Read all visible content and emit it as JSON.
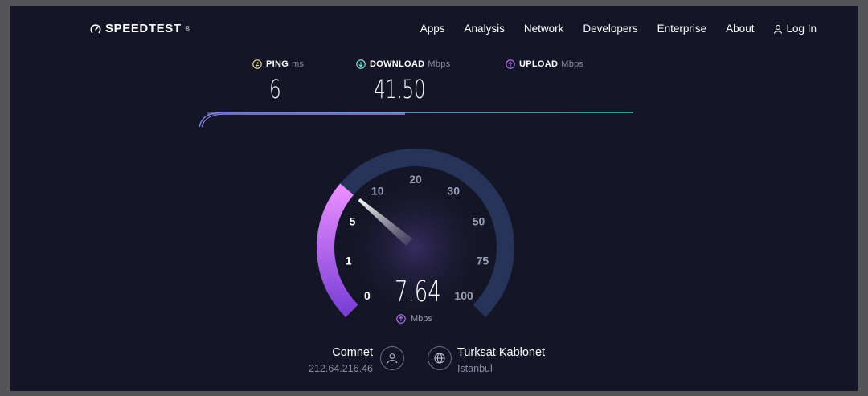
{
  "brand": {
    "name": "SPEEDTEST",
    "trademark": "®"
  },
  "nav": {
    "items": [
      "Apps",
      "Analysis",
      "Network",
      "Developers",
      "Enterprise",
      "About"
    ],
    "login": "Log In"
  },
  "metrics": {
    "ping": {
      "label": "PING",
      "unit": "ms",
      "value": "6",
      "color": "#f2e38b"
    },
    "download": {
      "label": "DOWNLOAD",
      "unit": "Mbps",
      "value": "41.50",
      "color": "#6afff3"
    },
    "upload": {
      "label": "UPLOAD",
      "unit": "Mbps",
      "value": "",
      "color": "#bf71ff"
    }
  },
  "gauge": {
    "ticks": [
      "0",
      "1",
      "5",
      "10",
      "20",
      "30",
      "50",
      "75",
      "100"
    ],
    "current_value": 7.64,
    "current_value_text": "7.64",
    "unit": "Mbps"
  },
  "isp": {
    "name": "Comnet",
    "ip": "212.64.216.46"
  },
  "server": {
    "name": "Turksat Kablonet",
    "location": "Istanbul"
  },
  "colors": {
    "background": "#141526",
    "gauge_track": "#26345a",
    "upload_arc_start": "#7b3fd6",
    "upload_arc_end": "#e88dff"
  }
}
